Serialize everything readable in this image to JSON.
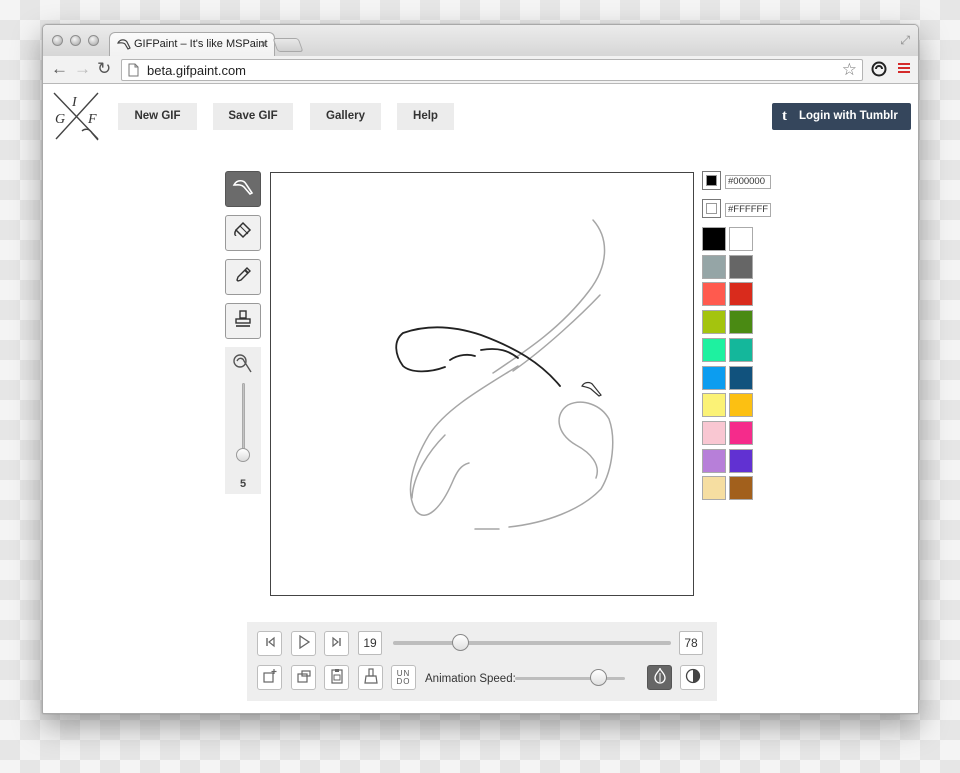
{
  "browser": {
    "tab_title": "GIFPaint – It's like MSPaint",
    "url": "beta.gifpaint.com"
  },
  "header": {
    "logo_letters": [
      "G",
      "I",
      "F"
    ],
    "nav": [
      {
        "label": "New GIF"
      },
      {
        "label": "Save GIF"
      },
      {
        "label": "Gallery"
      },
      {
        "label": "Help"
      }
    ],
    "login_label": "Login with Tumblr",
    "login_icon": "t"
  },
  "tools": {
    "items": [
      "brush-icon",
      "fill-bucket-icon",
      "eyedropper-icon",
      "stamp-icon"
    ],
    "active": "brush-icon",
    "brush_size": "5",
    "brush_size_fraction": 0.08
  },
  "colors": {
    "primary_hex": "#000000",
    "secondary_hex": "#FFFFFF",
    "palette": [
      [
        "#000000",
        "#FFFFFF"
      ],
      [
        "#95A5A6",
        "#666666"
      ],
      [
        "#FF5A4E",
        "#D92B1C"
      ],
      [
        "#A4C40E",
        "#4A8A13"
      ],
      [
        "#1EF1A0",
        "#14B79B"
      ],
      [
        "#0C9DF0",
        "#11527D"
      ],
      [
        "#FBF276",
        "#FCC012"
      ],
      [
        "#F9C7D2",
        "#F52B8B"
      ],
      [
        "#B77FD9",
        "#6131D2"
      ],
      [
        "#F6DEA1",
        "#A2601C"
      ]
    ]
  },
  "playback": {
    "current_frame": "19",
    "total_frames": "78",
    "frame_fraction": 0.24,
    "speed_label": "Animation Speed:",
    "speed_fraction": 0.75,
    "undo_label_top": "UN",
    "undo_label_bottom": "DO"
  }
}
